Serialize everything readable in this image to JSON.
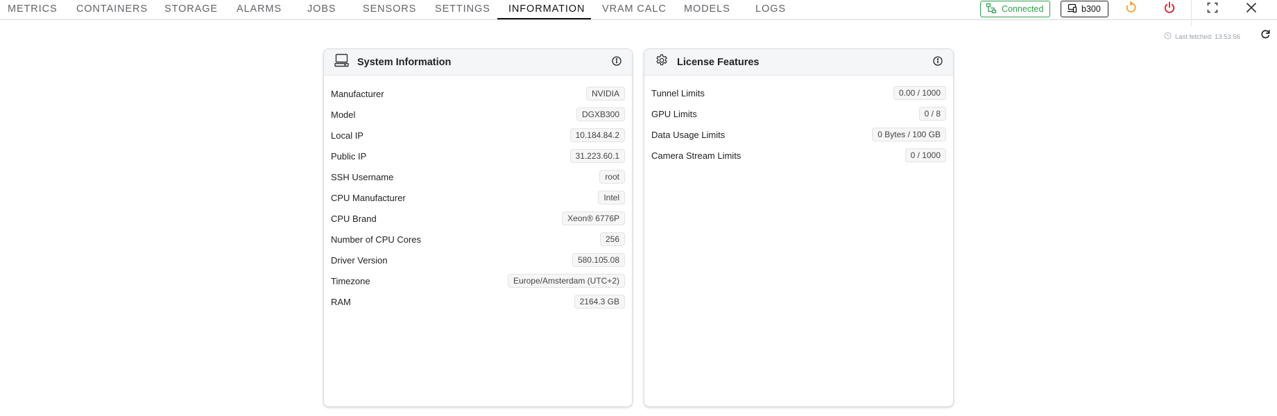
{
  "nav": {
    "tabs": [
      {
        "label": "METRICS"
      },
      {
        "label": "CONTAINERS"
      },
      {
        "label": "STORAGE"
      },
      {
        "label": "ALARMS"
      },
      {
        "label": "JOBS"
      },
      {
        "label": "SENSORS"
      },
      {
        "label": "SETTINGS"
      },
      {
        "label": "INFORMATION"
      },
      {
        "label": "VRAM CALC"
      },
      {
        "label": "MODELS"
      },
      {
        "label": "LOGS"
      }
    ],
    "active_tab": "INFORMATION"
  },
  "status": {
    "label": "Connected",
    "color": "#2e9e4a",
    "icon": "network-icon"
  },
  "host": {
    "label": "b300",
    "icon": "devices-icon"
  },
  "actions": {
    "restart_icon": "restart-icon",
    "restart_color": "#f0a020",
    "power_icon": "power-icon",
    "power_color": "#e0202a",
    "fullscreen_icon": "fullscreen-icon",
    "close_icon": "close-icon"
  },
  "last_fetched": {
    "label": "Last fetched: 13:53:56"
  },
  "system_info": {
    "title": "System Information",
    "rows": [
      {
        "label": "Manufacturer",
        "value": "NVIDIA"
      },
      {
        "label": "Model",
        "value": "DGXB300"
      },
      {
        "label": "Local IP",
        "value": "10.184.84.2"
      },
      {
        "label": "Public IP",
        "value": "31.223.60.1"
      },
      {
        "label": "SSH Username",
        "value": "root"
      },
      {
        "label": "CPU Manufacturer",
        "value": "Intel"
      },
      {
        "label": "CPU Brand",
        "value": "Xeon® 6776P"
      },
      {
        "label": "Number of CPU Cores",
        "value": "256"
      },
      {
        "label": "Driver Version",
        "value": "580.105.08"
      },
      {
        "label": "Timezone",
        "value": "Europe/Amsterdam (UTC+2)"
      },
      {
        "label": "RAM",
        "value": "2164.3 GB"
      }
    ]
  },
  "license": {
    "title": "License Features",
    "rows": [
      {
        "label": "Tunnel Limits",
        "value": "0.00 / 1000"
      },
      {
        "label": "GPU Limits",
        "value": "0 / 8"
      },
      {
        "label": "Data Usage Limits",
        "value": "0 Bytes / 100 GB"
      },
      {
        "label": "Camera Stream Limits",
        "value": "0 / 1000"
      }
    ]
  }
}
